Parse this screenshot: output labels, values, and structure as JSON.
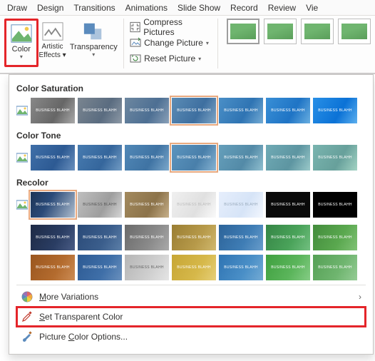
{
  "tabs": [
    "Draw",
    "Design",
    "Transitions",
    "Animations",
    "Slide Show",
    "Record",
    "Review",
    "Vie"
  ],
  "ribbon": {
    "color": "Color",
    "artistic": "Artistic Effects",
    "transparency": "Transparency",
    "compress": "Compress Pictures",
    "change": "Change Picture",
    "reset": "Reset Picture"
  },
  "dropdown": {
    "saturation_label": "Color Saturation",
    "tone_label": "Color Tone",
    "recolor_label": "Recolor",
    "thumb_caption": "BUSINESS BLAHH",
    "more_variations": "More Variations",
    "set_transparent": "Set Transparent Color",
    "picture_options": "Picture Color Options..."
  },
  "colors": {
    "saturation": [
      "#8a8a8a",
      "#7d8893",
      "#6d8aa3",
      "#5b8cb5",
      "#4a8fc7",
      "#398fd6",
      "#288fe6"
    ],
    "tone": [
      "#3f6fa8",
      "#477bb0",
      "#5188b7",
      "#5b94be",
      "#659fbb",
      "#6faab5",
      "#79b4af"
    ],
    "recolor_row1_sel": true,
    "recolor": [
      [
        "orig",
        "#c0c0c0",
        "#9e9e9e",
        "#7f7f7f",
        "#e6eefc",
        "#000000",
        "#0a0a0a"
      ],
      [
        "#2a3d63",
        "#3b5e8c",
        "#8a8a8a",
        "#b79a4a",
        "#3f7db5",
        "#4aa35a",
        "#5aa84f"
      ],
      [
        "#b36b2e",
        "#3f6fa8",
        "#8a8a8a",
        "#d6b84a",
        "#4a8fc7",
        "#5bb55b",
        "#6fb56f"
      ]
    ]
  }
}
